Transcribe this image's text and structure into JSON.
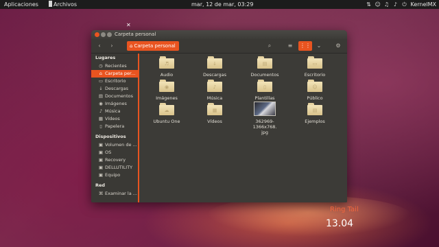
{
  "topbar": {
    "apps_label": "Aplicaciones",
    "files_menu_label": "Archivos",
    "clock": "mar, 12 de mar, 03:29",
    "user": "KernelMX",
    "tray_icons": [
      "network-icon",
      "accessibility-icon",
      "headphones-icon",
      "volume-icon",
      "power-icon"
    ]
  },
  "window": {
    "title": "Carpeta personal",
    "path_label": "Carpeta personal",
    "accent": "#e95420"
  },
  "sidebar": {
    "places_header": "Lugares",
    "places": [
      {
        "label": "Recientes",
        "icon": "clock-icon"
      },
      {
        "label": "Carpeta per...",
        "icon": "home-icon"
      },
      {
        "label": "Escritorio",
        "icon": "desktop-icon"
      },
      {
        "label": "Descargas",
        "icon": "download-icon"
      },
      {
        "label": "Documentos",
        "icon": "document-icon"
      },
      {
        "label": "Imágenes",
        "icon": "camera-icon"
      },
      {
        "label": "Música",
        "icon": "music-icon"
      },
      {
        "label": "Vídeos",
        "icon": "video-icon"
      },
      {
        "label": "Papelera",
        "icon": "trash-icon"
      }
    ],
    "devices_header": "Dispositivos",
    "devices": [
      {
        "label": "Volumen de ...",
        "icon": "drive-icon"
      },
      {
        "label": "OS",
        "icon": "drive-icon"
      },
      {
        "label": "Recovery",
        "icon": "drive-icon"
      },
      {
        "label": "DELLUTILITY",
        "icon": "drive-icon"
      },
      {
        "label": "Equipo",
        "icon": "drive-icon"
      }
    ],
    "network_header": "Red",
    "network": [
      {
        "label": "Examinar la ...",
        "icon": "network-icon"
      }
    ]
  },
  "files": [
    {
      "label": "Audio",
      "type": "folder"
    },
    {
      "label": "Descargas",
      "type": "folder"
    },
    {
      "label": "Documentos",
      "type": "folder"
    },
    {
      "label": "Escritorio",
      "type": "folder"
    },
    {
      "label": "Imágenes",
      "type": "folder"
    },
    {
      "label": "Música",
      "type": "folder"
    },
    {
      "label": "Plantillas",
      "type": "folder"
    },
    {
      "label": "Público",
      "type": "folder"
    },
    {
      "label": "Ubuntu One",
      "type": "folder"
    },
    {
      "label": "Vídeos",
      "type": "folder"
    },
    {
      "label": "362969-1366x768.",
      "label2": "jpg",
      "type": "image"
    },
    {
      "label": "Ejemplos",
      "type": "folder"
    }
  ],
  "branding": {
    "name": "Ring Tail",
    "version": "13.04"
  }
}
